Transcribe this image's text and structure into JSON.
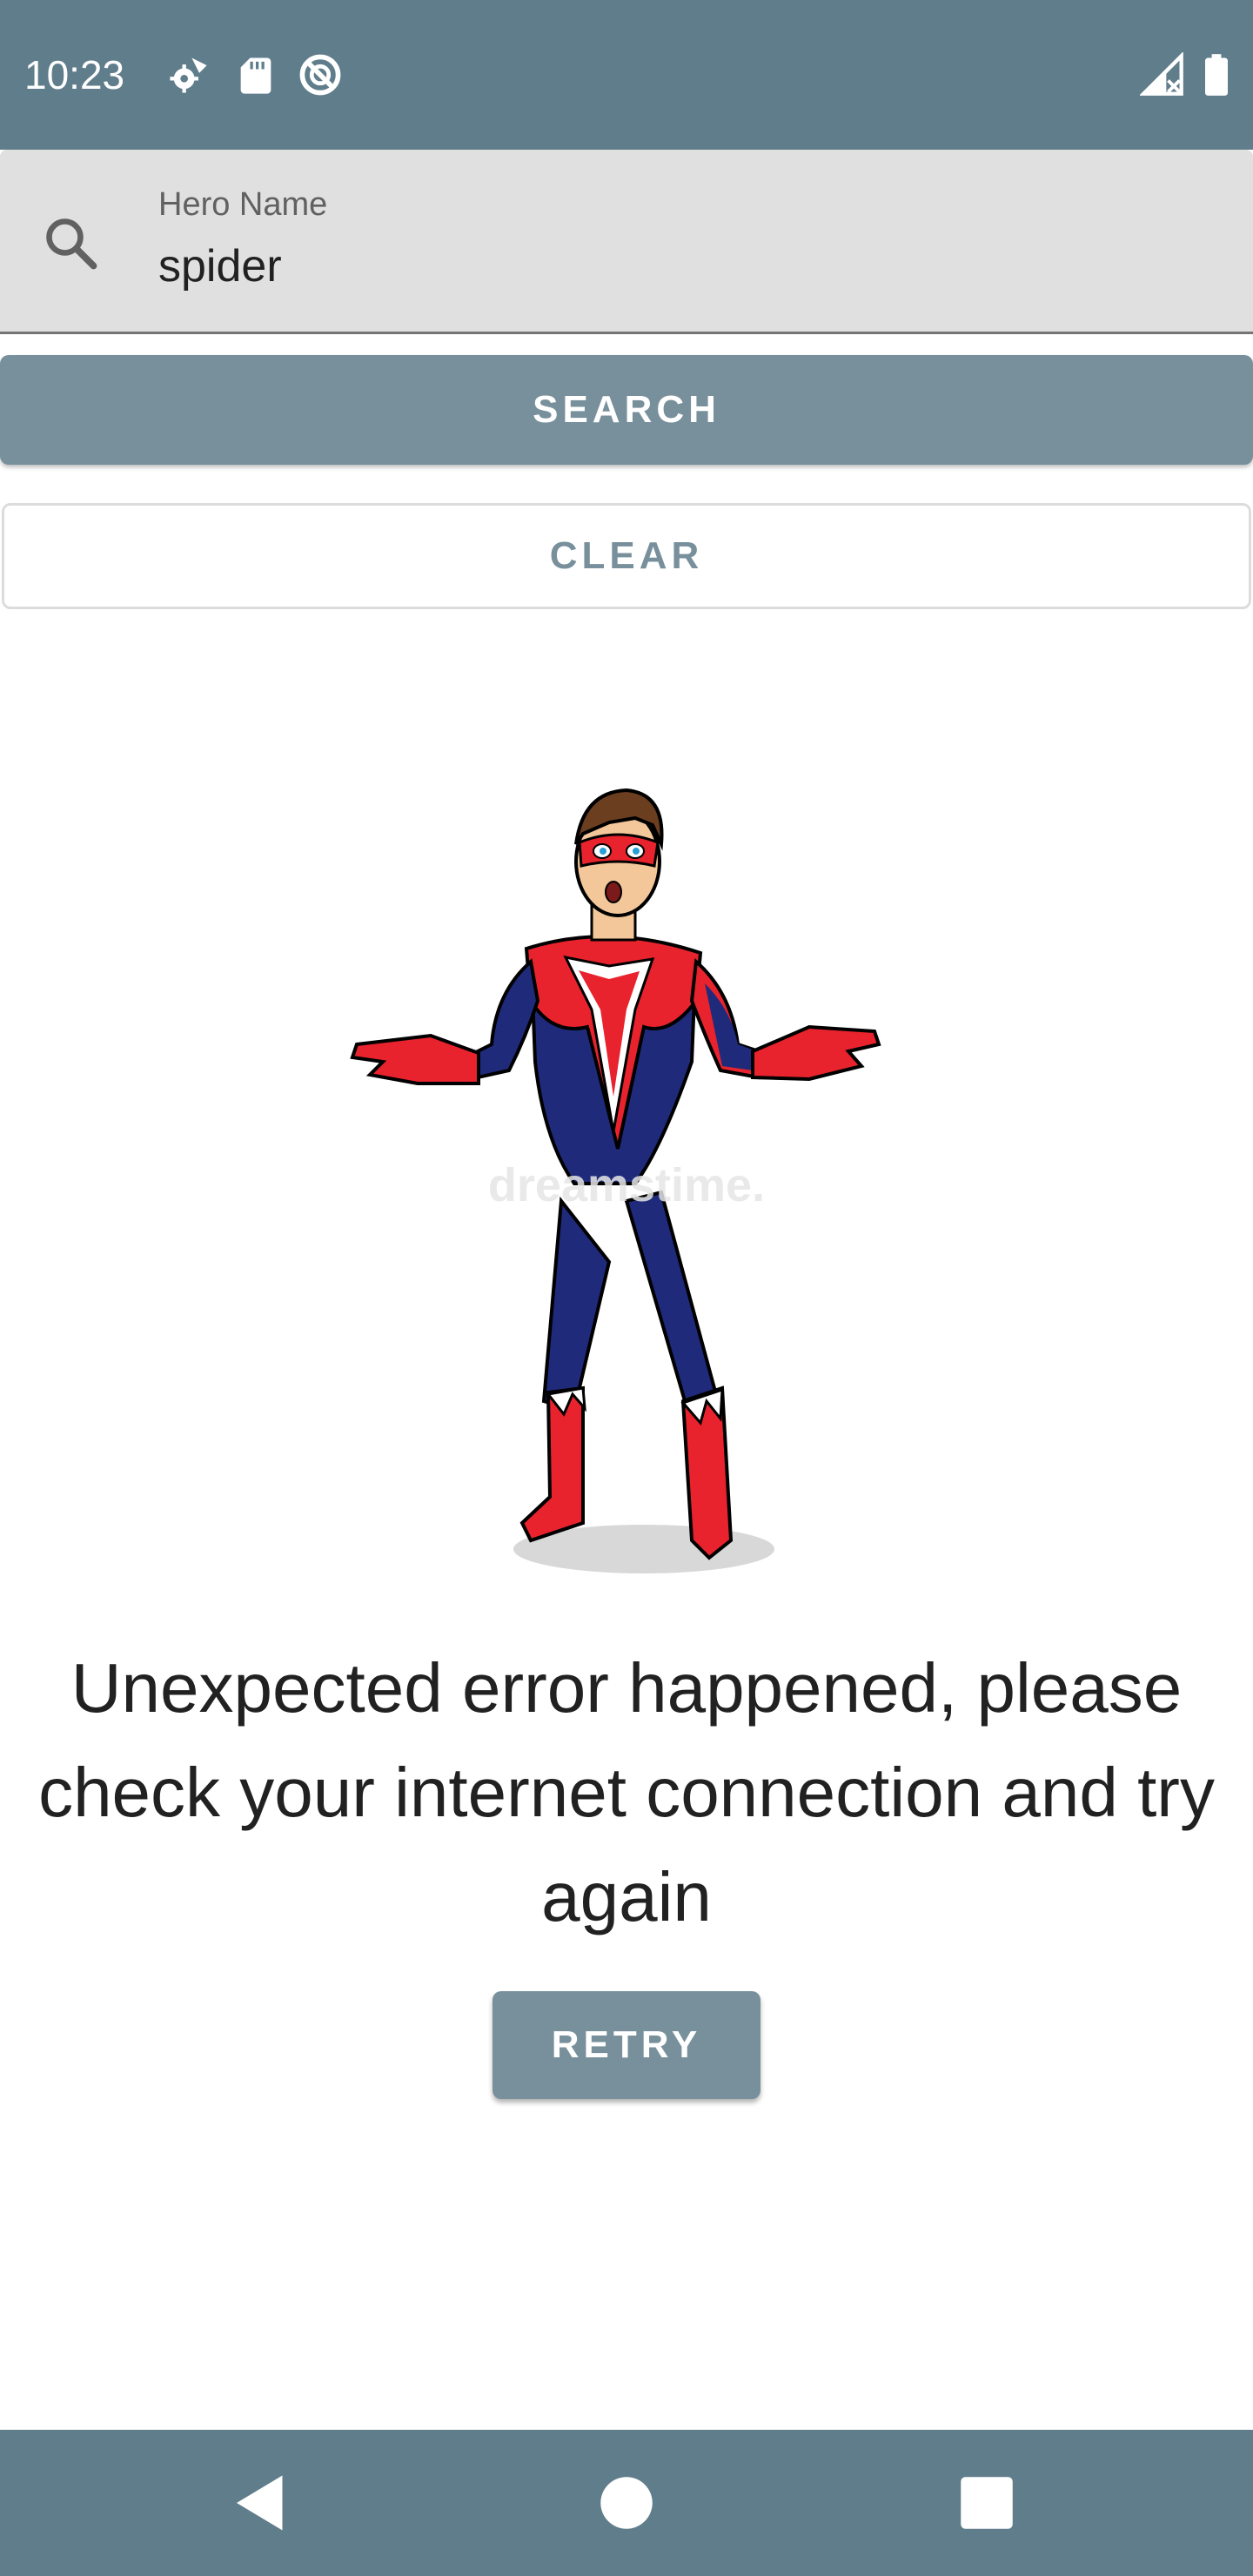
{
  "status_bar": {
    "time": "10:23",
    "icons": [
      "settings-gear-icon",
      "sd-card-icon",
      "no-sync-icon",
      "signal-off-icon",
      "battery-icon"
    ]
  },
  "search": {
    "label": "Hero Name",
    "value": "spider",
    "icon": "search-icon"
  },
  "buttons": {
    "search": "SEARCH",
    "clear": "CLEAR",
    "retry": "RETRY"
  },
  "illustration": {
    "icon": "confused-superhero-illustration",
    "watermark": "dreamstime."
  },
  "error": {
    "message": "Unexpected error happened, please check your internet connection and try again"
  },
  "nav_bar": {
    "icons": [
      "back-icon",
      "home-icon",
      "recents-icon"
    ]
  },
  "colors": {
    "status_bar": "#607d8b",
    "button_primary": "#78909c",
    "field_background": "#e0e0e0",
    "nav_bar": "#607d8b"
  }
}
